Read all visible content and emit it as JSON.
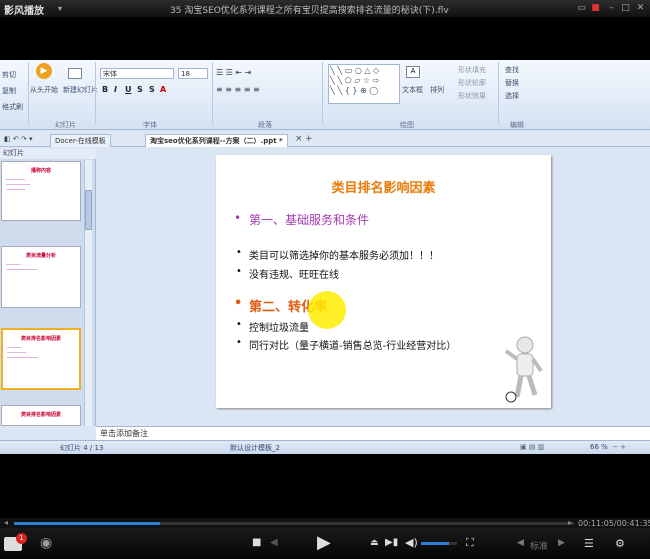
{
  "player": {
    "brand": "影风播放",
    "title": "35 淘宝SEO优化系列课程之所有宝贝提高搜索排名流量的秘诀(下).flv",
    "time": "00:11:05/00:41:35",
    "sub_label": "标准",
    "notification_count": "1",
    "progress": 0.26,
    "volume": 0.78
  },
  "ribbon": {
    "paste": "剪切",
    "copy": "复制",
    "format_painter": "格式刷",
    "play_from_start": "从头开始",
    "new_slide": "新建幻灯片",
    "font_name": "宋体",
    "font_size": "18",
    "group_slide": "幻灯片",
    "group_font": "字体",
    "group_paragraph": "段落",
    "group_drawing": "绘图",
    "group_edit": "编辑",
    "textbox": "文本框",
    "arrange": "排列",
    "shape_fill": "形状填充",
    "shape_outline": "形状轮廓",
    "shape_effect": "形状效果",
    "find": "查找",
    "replace": "替换",
    "select": "选择"
  },
  "tabs": [
    "Docer-在线模板",
    "淘宝seo优化系列课程--方案（二）.ppt *"
  ],
  "panel": {
    "header": "幻灯片",
    "thumbs": [
      {
        "title": "播称内容"
      },
      {
        "title": "类目流量分析"
      },
      {
        "title": "类目排名影响因素"
      },
      {
        "title": "类目排名影响因素"
      }
    ]
  },
  "slide": {
    "title": "类目排名影响因素",
    "section1": "第一、基础服务和条件",
    "b1": "类目可以筛选掉你的基本服务必须加！！！",
    "b2": "没有违规、旺旺在线",
    "section2": "第二、转化率",
    "b3": "控制垃圾流量",
    "b4": "同行对比（量子横道-销售总览-行业经营对比）"
  },
  "notes": "单击添加备注",
  "status": {
    "slide_count": "幻灯片 4 / 13",
    "template": "默认设计模板_2",
    "zoom": "66 %"
  }
}
